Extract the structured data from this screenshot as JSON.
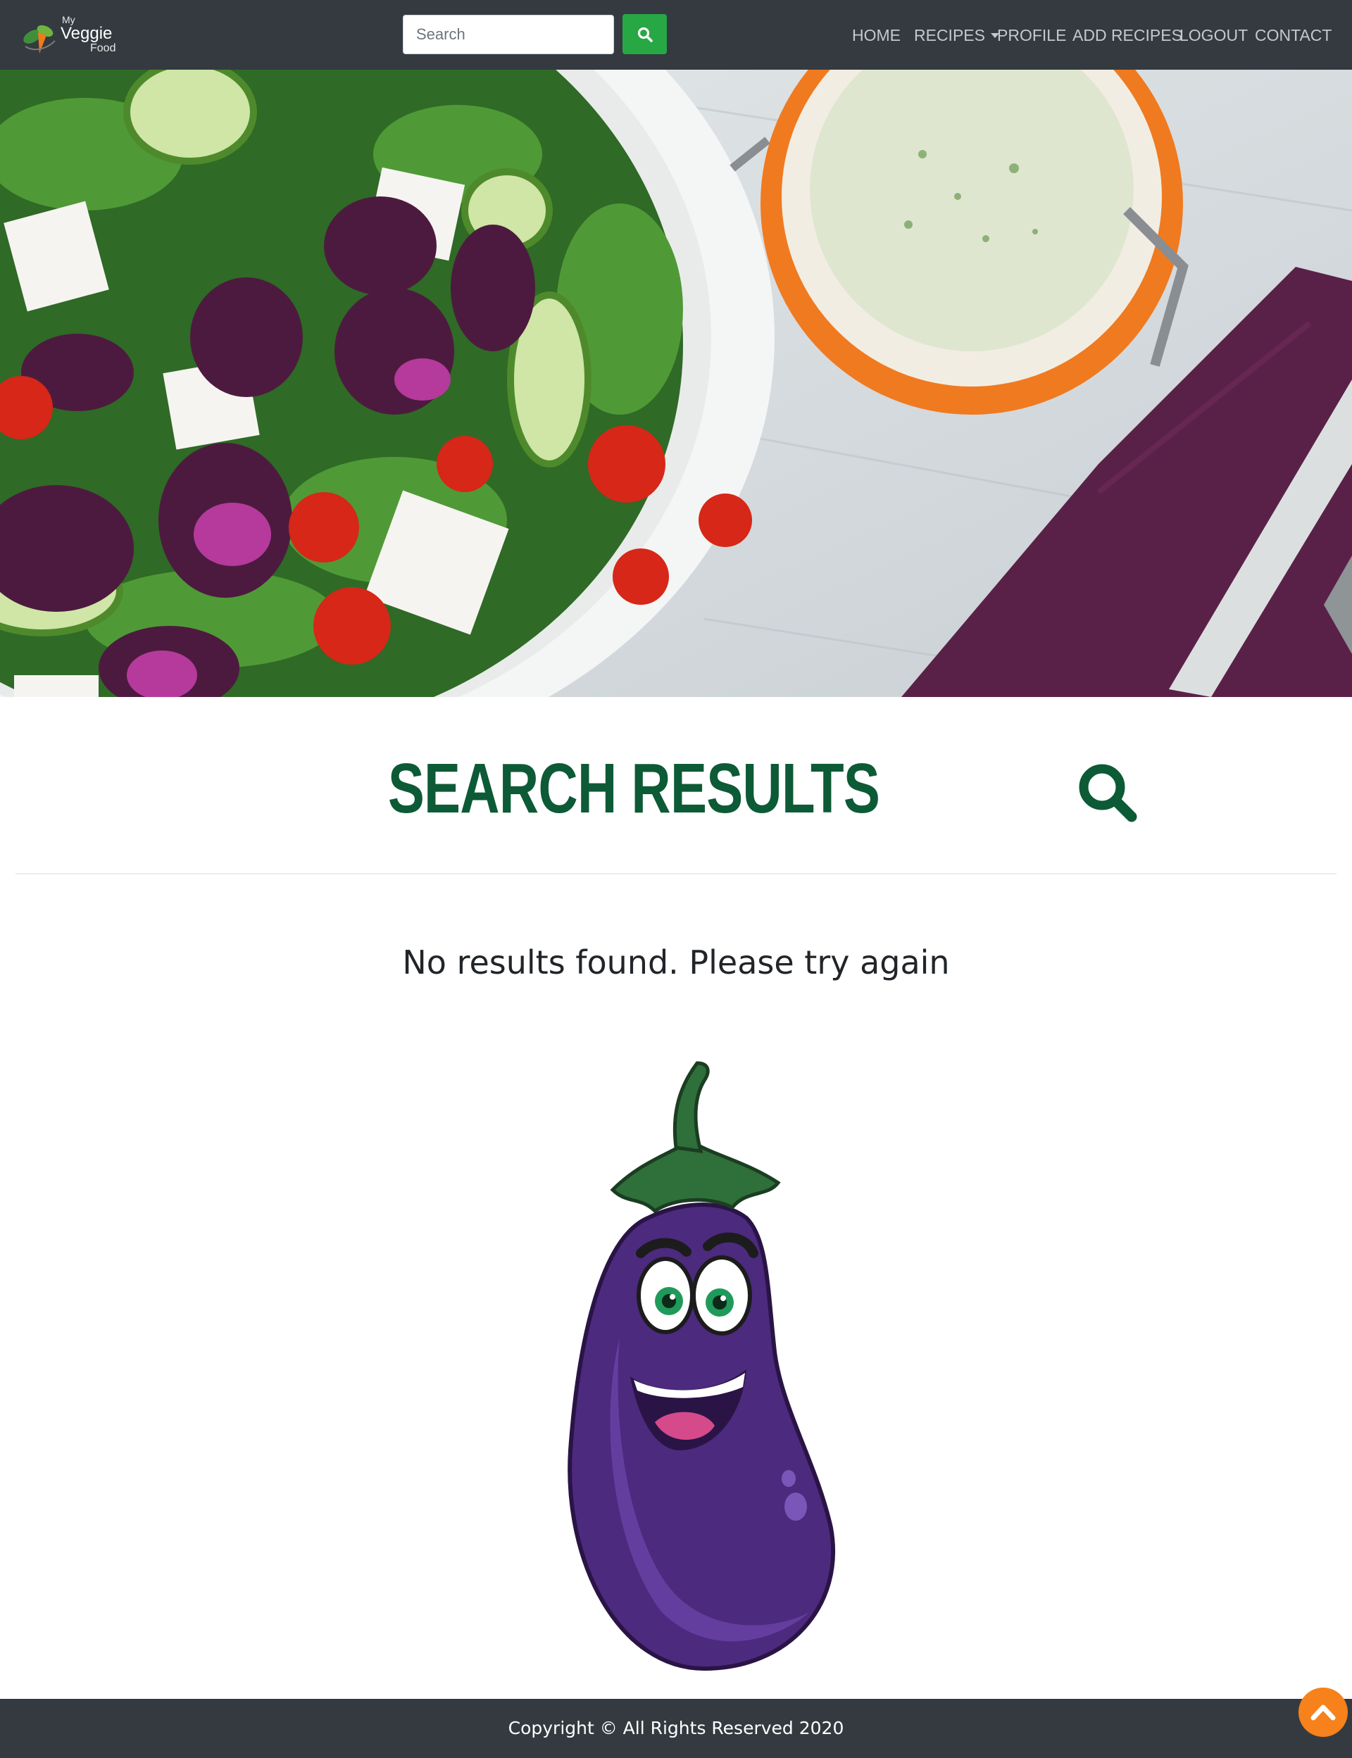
{
  "brand": {
    "logo_line1": "My",
    "logo_line2": "Veggie",
    "logo_line3": "Food"
  },
  "search": {
    "placeholder": "Search",
    "value": "",
    "button_icon": "search-icon"
  },
  "nav": {
    "items": [
      {
        "label": "HOME"
      },
      {
        "label": "RECIPES",
        "has_dropdown": true
      },
      {
        "label": "PROFILE"
      },
      {
        "label": "ADD RECIPES"
      },
      {
        "label": "LOGOUT"
      },
      {
        "label": "CONTACT"
      }
    ]
  },
  "main": {
    "title": "SEARCH RESULTS",
    "title_icon": "search-icon",
    "message": "No results found. Please try again"
  },
  "footer": {
    "copyright": "Copyright © All Rights Reserved 2020"
  },
  "colors": {
    "navbar_bg": "#343a40",
    "search_button": "#28a745",
    "heading_green": "#0d5a36",
    "back_to_top": "#f7811b"
  }
}
